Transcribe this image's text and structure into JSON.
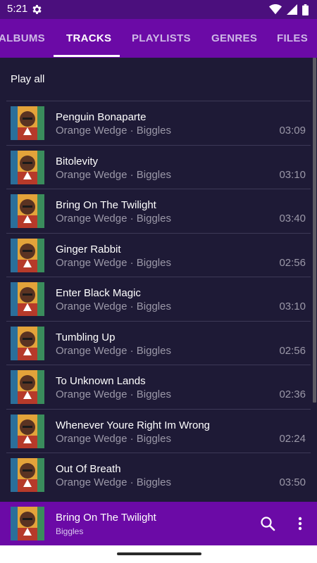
{
  "status_bar": {
    "time": "5:21"
  },
  "tabs": [
    {
      "label": "ALBUMS",
      "active": false
    },
    {
      "label": "TRACKS",
      "active": true
    },
    {
      "label": "PLAYLISTS",
      "active": false
    },
    {
      "label": "GENRES",
      "active": false
    },
    {
      "label": "FILES",
      "active": false
    }
  ],
  "play_all_label": "Play all",
  "tracks": [
    {
      "title": "Penguin Bonaparte",
      "subtitle": "Orange Wedge · Biggles",
      "duration": "03:09"
    },
    {
      "title": "Bitolevity",
      "subtitle": "Orange Wedge · Biggles",
      "duration": "03:10"
    },
    {
      "title": "Bring On The Twilight",
      "subtitle": "Orange Wedge · Biggles",
      "duration": "03:40"
    },
    {
      "title": "Ginger Rabbit",
      "subtitle": "Orange Wedge · Biggles",
      "duration": "02:56"
    },
    {
      "title": "Enter Black Magic",
      "subtitle": "Orange Wedge · Biggles",
      "duration": "03:10"
    },
    {
      "title": "Tumbling Up",
      "subtitle": "Orange Wedge · Biggles",
      "duration": "02:56"
    },
    {
      "title": "To Unknown Lands",
      "subtitle": "Orange Wedge · Biggles",
      "duration": "02:36"
    },
    {
      "title": "Whenever Youre Right Im Wrong",
      "subtitle": "Orange Wedge · Biggles",
      "duration": "02:24"
    },
    {
      "title": "Out Of Breath",
      "subtitle": "Orange Wedge · Biggles",
      "duration": "03:50"
    }
  ],
  "now_playing": {
    "title": "Bring On The Twilight",
    "artist": "Biggles"
  },
  "icons": {
    "status": [
      "gear-icon",
      "wifi-icon",
      "signal-icon",
      "battery-icon"
    ],
    "mini_player": [
      "search-icon",
      "more-vert-icon"
    ]
  },
  "colors": {
    "status_bar": "#4b0f7d",
    "tab_bar": "#6b0aa6",
    "background": "#1e1a36",
    "secondary_text": "#9b98a8"
  }
}
